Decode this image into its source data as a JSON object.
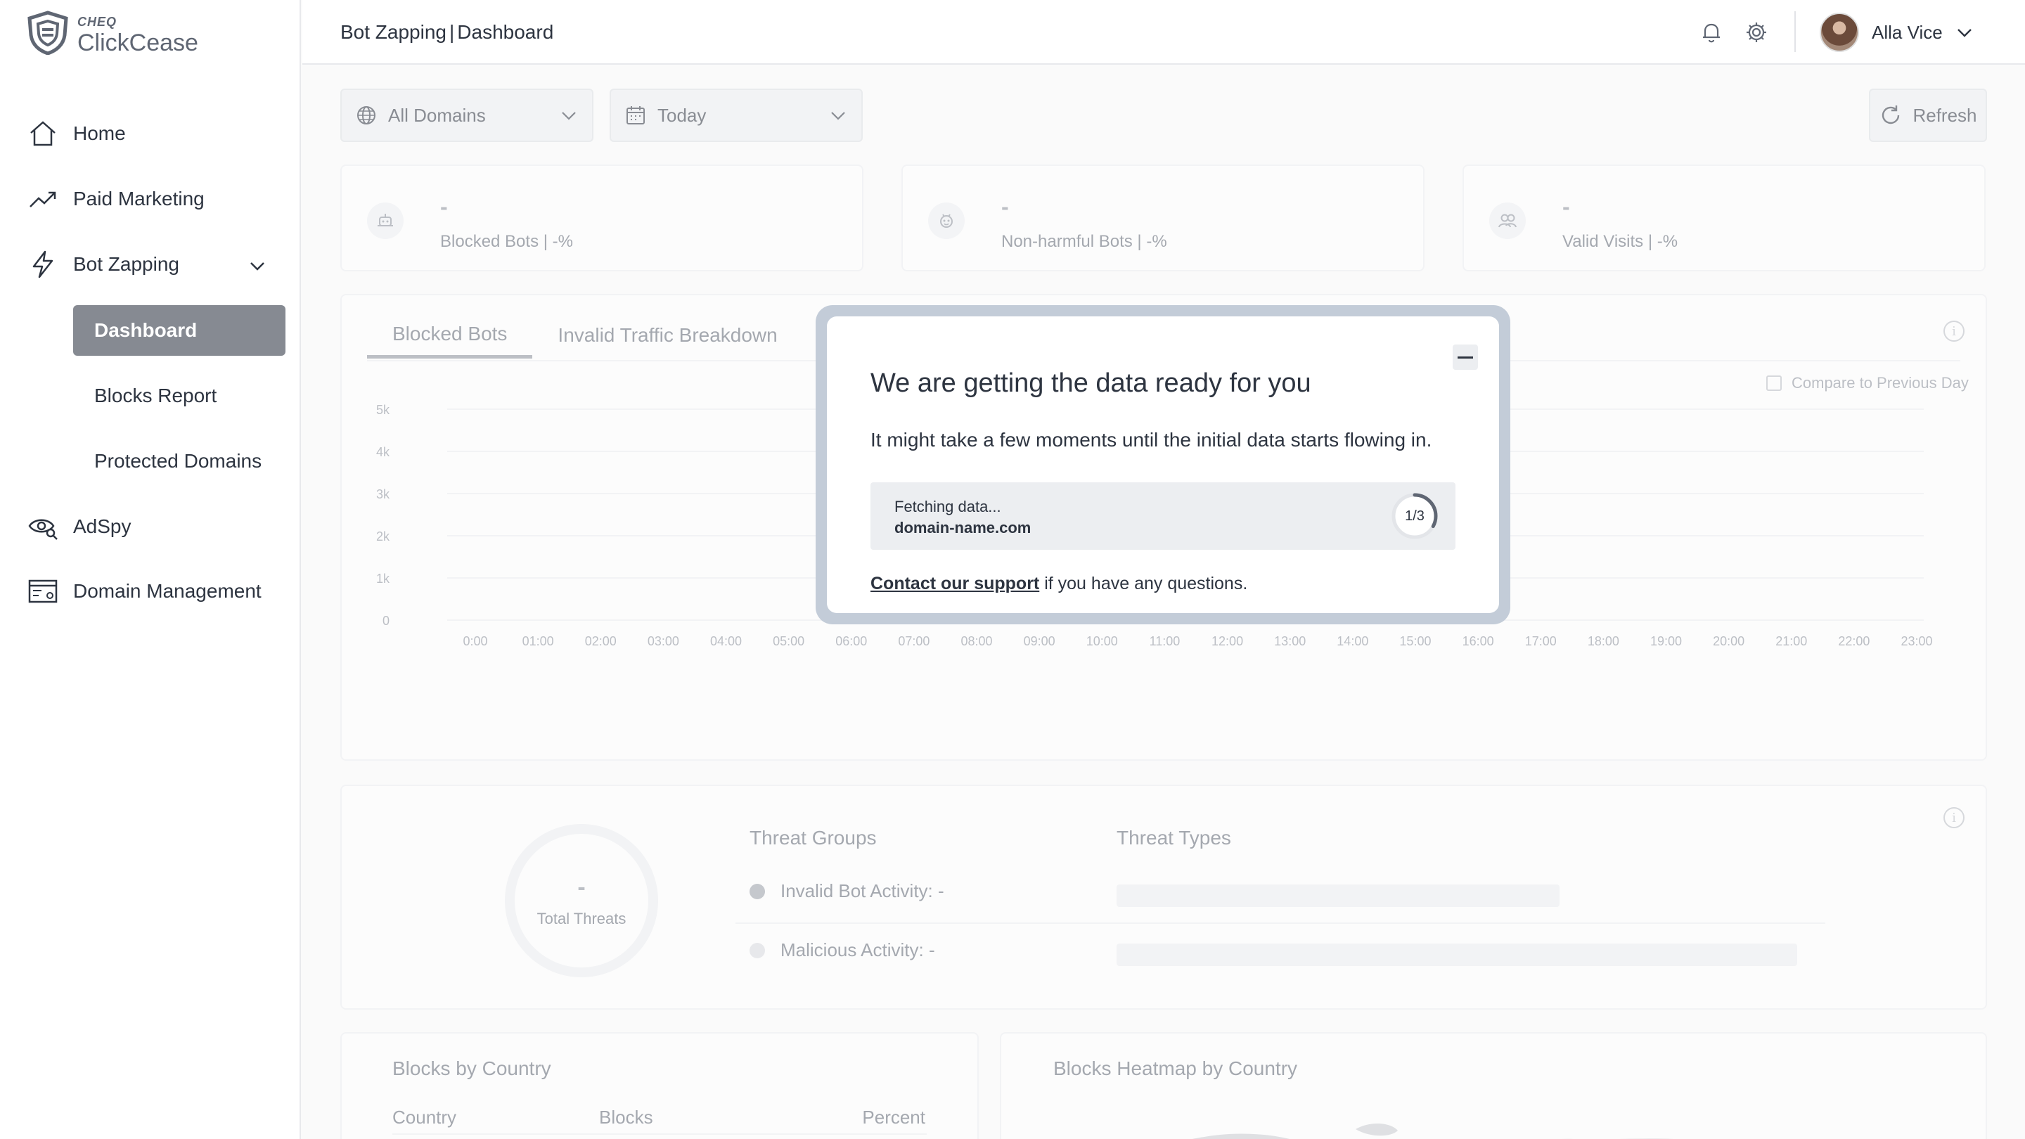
{
  "logo": {
    "brand": "CHEQ",
    "product": "ClickCease"
  },
  "sidebar": {
    "items": [
      {
        "label": "Home"
      },
      {
        "label": "Paid Marketing"
      },
      {
        "label": "Bot Zapping"
      },
      {
        "label": "AdSpy"
      },
      {
        "label": "Domain Management"
      }
    ],
    "sub_items": [
      {
        "label": "Dashboard",
        "active": true
      },
      {
        "label": "Blocks Report"
      },
      {
        "label": "Protected Domains"
      }
    ]
  },
  "header": {
    "breadcrumb_section": "Bot Zapping",
    "breadcrumb_separator": "|",
    "breadcrumb_page": "Dashboard",
    "user_name": "Alla Vice"
  },
  "filters": {
    "domains_label": "All Domains",
    "date_label": "Today",
    "refresh_label": "Refresh"
  },
  "kpis": [
    {
      "value": "-",
      "label": "Blocked Bots",
      "delta": " | -%"
    },
    {
      "value": "-",
      "label": "Non-harmful Bots",
      "delta": " | -%"
    },
    {
      "value": "-",
      "label": "Valid Visits",
      "delta": " | -%"
    }
  ],
  "chart_card": {
    "tabs": [
      "Blocked Bots",
      "Invalid Traffic Breakdown"
    ],
    "compare_label": "Compare to Previous Day"
  },
  "chart_data": {
    "type": "line",
    "x": [
      "0:00",
      "01:00",
      "02:00",
      "03:00",
      "04:00",
      "05:00",
      "06:00",
      "07:00",
      "08:00",
      "09:00",
      "10:00",
      "11:00",
      "12:00",
      "13:00",
      "14:00",
      "15:00",
      "16:00",
      "17:00",
      "18:00",
      "19:00",
      "20:00",
      "21:00",
      "22:00",
      "23:00"
    ],
    "y_ticks": [
      "0",
      "1k",
      "2k",
      "3k",
      "4k",
      "5k"
    ],
    "ylim": [
      0,
      5000
    ],
    "series": [],
    "grid": true
  },
  "threats": {
    "total_value": "-",
    "total_label": "Total Threats",
    "groups_title": "Threat Groups",
    "types_title": "Threat Types",
    "groups": [
      {
        "label": "Invalid Bot Activity: -",
        "color": "#9aa0a9"
      },
      {
        "label": "Malicious Activity: -",
        "color": "#d8dbe0"
      }
    ]
  },
  "country_table": {
    "title": "Blocks by Country",
    "columns": [
      "Country",
      "Blocks",
      "Percent"
    ]
  },
  "heatmap": {
    "title": "Blocks Heatmap by Country"
  },
  "modal": {
    "title": "We are getting the data ready for you",
    "text": "It might take a few moments until the initial data starts flowing in.",
    "fetch_status": "Fetching data...",
    "fetch_domain": "domain-name.com",
    "progress_label": "1/3",
    "progress_fraction": 0.33,
    "support_link": "Contact our support",
    "support_suffix": " if you have any questions."
  },
  "colors": {
    "active_nav": "#868a92",
    "modal_frame": "#c3ccd8",
    "text": "#2d3440"
  }
}
